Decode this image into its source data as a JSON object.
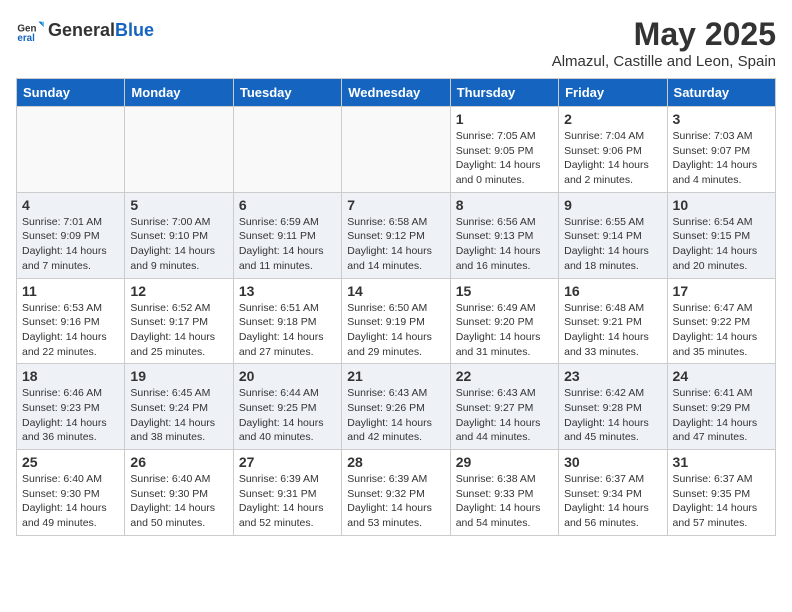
{
  "header": {
    "logo_general": "General",
    "logo_blue": "Blue",
    "title": "May 2025",
    "subtitle": "Almazul, Castille and Leon, Spain"
  },
  "days_of_week": [
    "Sunday",
    "Monday",
    "Tuesday",
    "Wednesday",
    "Thursday",
    "Friday",
    "Saturday"
  ],
  "weeks": [
    [
      {
        "day": "",
        "empty": true
      },
      {
        "day": "",
        "empty": true
      },
      {
        "day": "",
        "empty": true
      },
      {
        "day": "",
        "empty": true
      },
      {
        "day": "1",
        "sunrise": "7:05 AM",
        "sunset": "9:05 PM",
        "daylight": "14 hours and 0 minutes."
      },
      {
        "day": "2",
        "sunrise": "7:04 AM",
        "sunset": "9:06 PM",
        "daylight": "14 hours and 2 minutes."
      },
      {
        "day": "3",
        "sunrise": "7:03 AM",
        "sunset": "9:07 PM",
        "daylight": "14 hours and 4 minutes."
      }
    ],
    [
      {
        "day": "4",
        "sunrise": "7:01 AM",
        "sunset": "9:09 PM",
        "daylight": "14 hours and 7 minutes."
      },
      {
        "day": "5",
        "sunrise": "7:00 AM",
        "sunset": "9:10 PM",
        "daylight": "14 hours and 9 minutes."
      },
      {
        "day": "6",
        "sunrise": "6:59 AM",
        "sunset": "9:11 PM",
        "daylight": "14 hours and 11 minutes."
      },
      {
        "day": "7",
        "sunrise": "6:58 AM",
        "sunset": "9:12 PM",
        "daylight": "14 hours and 14 minutes."
      },
      {
        "day": "8",
        "sunrise": "6:56 AM",
        "sunset": "9:13 PM",
        "daylight": "14 hours and 16 minutes."
      },
      {
        "day": "9",
        "sunrise": "6:55 AM",
        "sunset": "9:14 PM",
        "daylight": "14 hours and 18 minutes."
      },
      {
        "day": "10",
        "sunrise": "6:54 AM",
        "sunset": "9:15 PM",
        "daylight": "14 hours and 20 minutes."
      }
    ],
    [
      {
        "day": "11",
        "sunrise": "6:53 AM",
        "sunset": "9:16 PM",
        "daylight": "14 hours and 22 minutes."
      },
      {
        "day": "12",
        "sunrise": "6:52 AM",
        "sunset": "9:17 PM",
        "daylight": "14 hours and 25 minutes."
      },
      {
        "day": "13",
        "sunrise": "6:51 AM",
        "sunset": "9:18 PM",
        "daylight": "14 hours and 27 minutes."
      },
      {
        "day": "14",
        "sunrise": "6:50 AM",
        "sunset": "9:19 PM",
        "daylight": "14 hours and 29 minutes."
      },
      {
        "day": "15",
        "sunrise": "6:49 AM",
        "sunset": "9:20 PM",
        "daylight": "14 hours and 31 minutes."
      },
      {
        "day": "16",
        "sunrise": "6:48 AM",
        "sunset": "9:21 PM",
        "daylight": "14 hours and 33 minutes."
      },
      {
        "day": "17",
        "sunrise": "6:47 AM",
        "sunset": "9:22 PM",
        "daylight": "14 hours and 35 minutes."
      }
    ],
    [
      {
        "day": "18",
        "sunrise": "6:46 AM",
        "sunset": "9:23 PM",
        "daylight": "14 hours and 36 minutes."
      },
      {
        "day": "19",
        "sunrise": "6:45 AM",
        "sunset": "9:24 PM",
        "daylight": "14 hours and 38 minutes."
      },
      {
        "day": "20",
        "sunrise": "6:44 AM",
        "sunset": "9:25 PM",
        "daylight": "14 hours and 40 minutes."
      },
      {
        "day": "21",
        "sunrise": "6:43 AM",
        "sunset": "9:26 PM",
        "daylight": "14 hours and 42 minutes."
      },
      {
        "day": "22",
        "sunrise": "6:43 AM",
        "sunset": "9:27 PM",
        "daylight": "14 hours and 44 minutes."
      },
      {
        "day": "23",
        "sunrise": "6:42 AM",
        "sunset": "9:28 PM",
        "daylight": "14 hours and 45 minutes."
      },
      {
        "day": "24",
        "sunrise": "6:41 AM",
        "sunset": "9:29 PM",
        "daylight": "14 hours and 47 minutes."
      }
    ],
    [
      {
        "day": "25",
        "sunrise": "6:40 AM",
        "sunset": "9:30 PM",
        "daylight": "14 hours and 49 minutes."
      },
      {
        "day": "26",
        "sunrise": "6:40 AM",
        "sunset": "9:30 PM",
        "daylight": "14 hours and 50 minutes."
      },
      {
        "day": "27",
        "sunrise": "6:39 AM",
        "sunset": "9:31 PM",
        "daylight": "14 hours and 52 minutes."
      },
      {
        "day": "28",
        "sunrise": "6:39 AM",
        "sunset": "9:32 PM",
        "daylight": "14 hours and 53 minutes."
      },
      {
        "day": "29",
        "sunrise": "6:38 AM",
        "sunset": "9:33 PM",
        "daylight": "14 hours and 54 minutes."
      },
      {
        "day": "30",
        "sunrise": "6:37 AM",
        "sunset": "9:34 PM",
        "daylight": "14 hours and 56 minutes."
      },
      {
        "day": "31",
        "sunrise": "6:37 AM",
        "sunset": "9:35 PM",
        "daylight": "14 hours and 57 minutes."
      }
    ]
  ],
  "labels": {
    "sunrise": "Sunrise:",
    "sunset": "Sunset:",
    "daylight": "Daylight:"
  }
}
